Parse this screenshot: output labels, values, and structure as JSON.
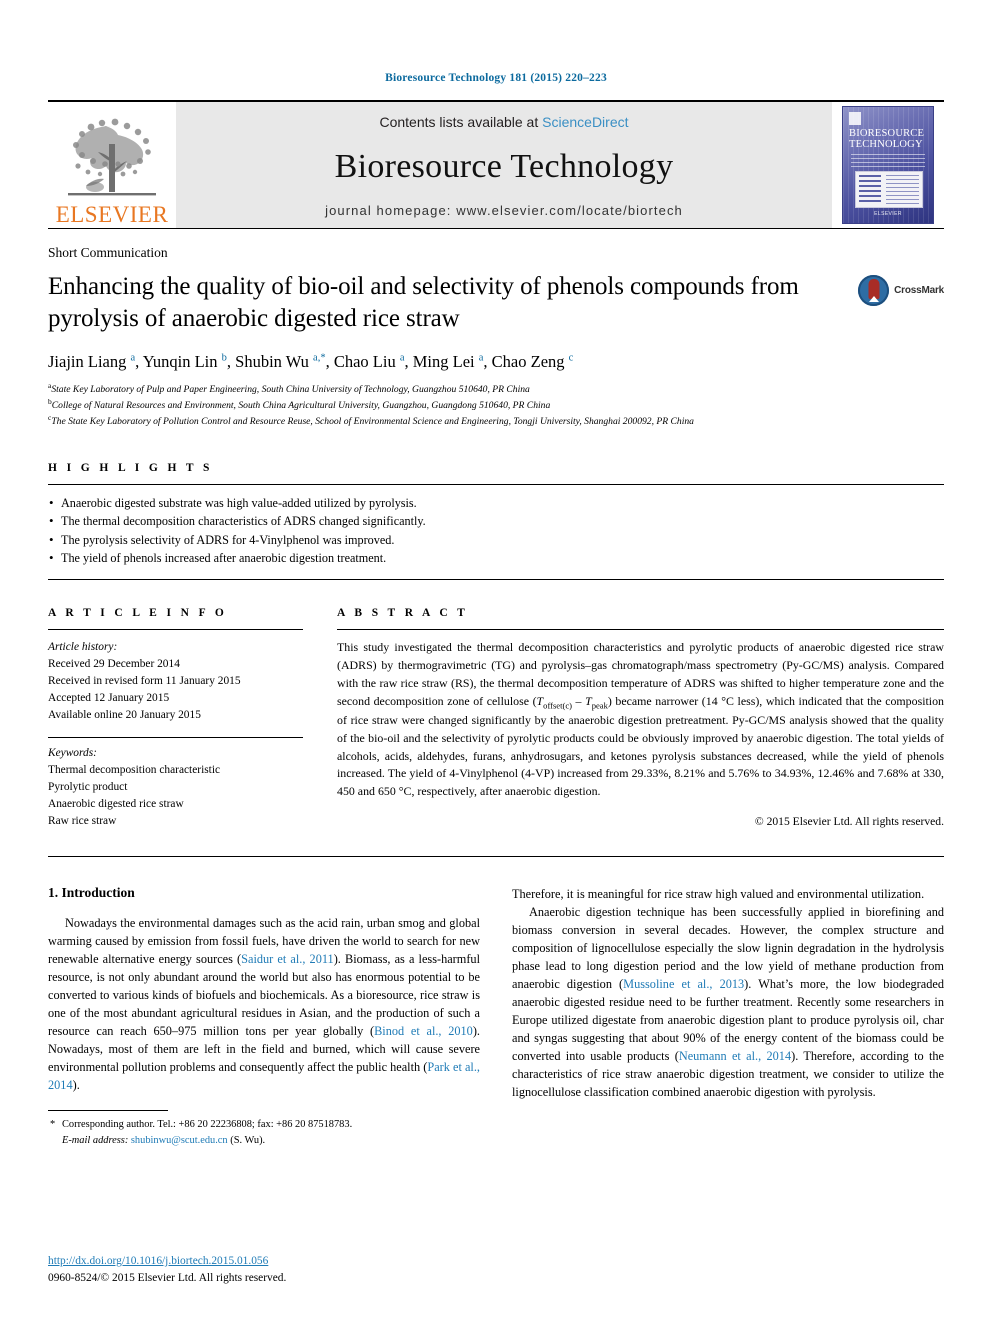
{
  "running_head": "Bioresource Technology 181 (2015) 220–223",
  "masthead": {
    "contents_prefix": "Contents lists available at",
    "sciencedirect": "ScienceDirect",
    "journal_title": "Bioresource Technology",
    "homepage": "journal homepage: www.elsevier.com/locate/biortech",
    "elsevier_wordmark": "ELSEVIER",
    "cover_title_line1": "BIORESOURCE",
    "cover_title_line2": "TECHNOLOGY",
    "cover_footer": "ELSEVIER",
    "accent_link_color": "#3a8fc4",
    "elsevier_orange": "#e87722"
  },
  "article": {
    "section_type": "Short Communication",
    "title": "Enhancing the quality of bio-oil and selectivity of phenols compounds from pyrolysis of anaerobic digested rice straw",
    "crossmark_label": "CrossMark",
    "authors_html": "Jiajin Liang <sup>a</sup>, Yunqin Lin <sup>b</sup>, Shubin Wu <sup>a,*</sup>, Chao Liu <sup>a</sup>, Ming Lei <sup>a</sup>, Chao Zeng <sup>c</sup>",
    "affiliations": [
      {
        "idx": "a",
        "text": "State Key Laboratory of Pulp and Paper Engineering, South China University of Technology, Guangzhou 510640, PR China"
      },
      {
        "idx": "b",
        "text": "College of Natural Resources and Environment, South China Agricultural University, Guangzhou, Guangdong 510640, PR China"
      },
      {
        "idx": "c",
        "text": "The State Key Laboratory of Pollution Control and Resource Reuse, School of Environmental Science and Engineering, Tongji University, Shanghai 200092, PR China"
      }
    ]
  },
  "highlights": {
    "label": "H I G H L I G H T S",
    "items": [
      "Anaerobic digested substrate was high value-added utilized by pyrolysis.",
      "The thermal decomposition characteristics of ADRS changed significantly.",
      "The pyrolysis selectivity of ADRS for 4-Vinylphenol was improved.",
      "The yield of phenols increased after anaerobic digestion treatment."
    ]
  },
  "article_info": {
    "label": "A R T I C L E   I N F O",
    "history_label": "Article history:",
    "history": [
      "Received 29 December 2014",
      "Received in revised form 11 January 2015",
      "Accepted 12 January 2015",
      "Available online 20 January 2015"
    ],
    "keywords_label": "Keywords:",
    "keywords": [
      "Thermal decomposition characteristic",
      "Pyrolytic product",
      "Anaerobic digested rice straw",
      "Raw rice straw"
    ]
  },
  "abstract": {
    "label": "A B S T R A C T",
    "text_html": "This study investigated the thermal decomposition characteristics and pyrolytic products of anaerobic digested rice straw (ADRS) by thermogravimetric (TG) and pyrolysis–gas chromatograph/mass spectrometry (Py-GC/MS) analysis. Compared with the raw rice straw (RS), the thermal decomposition temperature of ADRS was shifted to higher temperature zone and the second decomposition zone of cellulose (<i>T</i><sub>offset(c)</sub> &ndash; <i>T</i><sub>peak</sub>) became narrower (14 &deg;C less), which indicated that the composition of rice straw were changed significantly by the anaerobic digestion pretreatment. Py-GC/MS analysis showed that the quality of the bio-oil and the selectivity of pyrolytic products could be obviously improved by anaerobic digestion. The total yields of alcohols, acids, aldehydes, furans, anhydrosugars, and ketones pyrolysis substances decreased, while the yield of phenols increased. The yield of 4-Vinylphenol (4-VP) increased from 29.33%, 8.21% and 5.76% to 34.93%, 12.46% and 7.68% at 330, 450 and 650 &deg;C, respectively, after anaerobic digestion.",
    "copyright": "© 2015 Elsevier Ltd. All rights reserved."
  },
  "body": {
    "intro_heading": "1. Introduction",
    "left_paragraph_html": "Nowadays the environmental damages such as the acid rain, urban smog and global warming caused by emission from fossil fuels, have driven the world to search for new renewable alternative energy sources (<span class=\"link\">Saidur et al., 2011</span>). Biomass, as a less-harmful resource, is not only abundant around the world but also has enormous potential to be converted to various kinds of biofuels and biochemicals. As a bioresource, rice straw is one of the most abundant agricultural residues in Asian, and the production of such a resource can reach 650&ndash;975 million tons per year globally (<span class=\"link\">Binod et al., 2010</span>). Nowadays, most of them are left in the field and burned, which will cause severe environmental pollution problems and consequently affect the public health (<span class=\"link\">Park et al., 2014</span>).",
    "right_paragraph_1_html": "Therefore, it is meaningful for rice straw high valued and environmental utilization.",
    "right_paragraph_2_html": "Anaerobic digestion technique has been successfully applied in biorefining and biomass conversion in several decades. However, the complex structure and composition of lignocellulose especially the slow lignin degradation in the hydrolysis phase lead to long digestion period and the low yield of methane production from anaerobic digestion (<span class=\"link\">Mussoline et al., 2013</span>). What&rsquo;s more, the low biodegraded anaerobic digested residue need to be further treatment. Recently some researchers in Europe utilized digestate from anaerobic digestion plant to produce pyrolysis oil, char and syngas suggesting that about 90% of the energy content of the biomass could be converted into usable products (<span class=\"link\">Neumann et al., 2014</span>). Therefore, according to the characteristics of rice straw anaerobic digestion treatment, we consider to utilize the lignocellulose classification combined anaerobic digestion with pyrolysis."
  },
  "footnote": {
    "corresponding_html": "Corresponding author. Tel.: +86 20 22236808; fax: +86 20 87518783.",
    "email_label": "E-mail address:",
    "email": "shubinwu@scut.edu.cn",
    "email_suffix": "(S. Wu)."
  },
  "doi_block": {
    "doi_url": "http://dx.doi.org/10.1016/j.biortech.2015.01.056",
    "issn_copyright": "0960-8524/© 2015 Elsevier Ltd. All rights reserved."
  }
}
